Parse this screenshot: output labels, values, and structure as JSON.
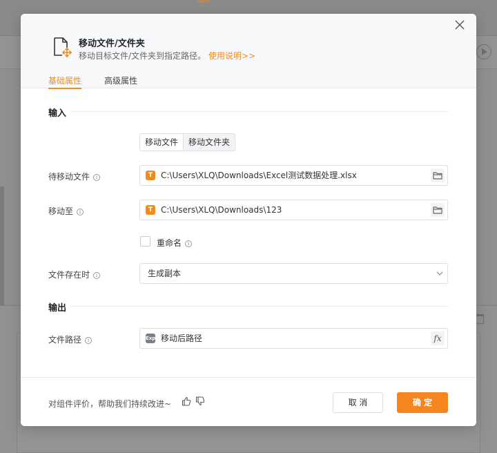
{
  "dialog": {
    "title": "移动文件/文件夹",
    "description": "移动目标文件/文件夹到指定路径。",
    "help_link": "使用说明>>",
    "tabs": {
      "basic": "基础属性",
      "advanced": "高级属性"
    }
  },
  "input_section": {
    "title": "输入",
    "mode": {
      "options": [
        "移动文件",
        "移动文件夹"
      ],
      "selected": "移动文件夹"
    },
    "source_file": {
      "label": "待移动文件",
      "value": "C:\\Users\\XLQ\\Downloads\\Excel测试数据处理.xlsx",
      "badge": "T"
    },
    "destination": {
      "label": "移动至",
      "value": "C:\\Users\\XLQ\\Downloads\\123",
      "badge": "T"
    },
    "rename": {
      "label": "重命名",
      "checked": false
    },
    "on_exists": {
      "label": "文件存在时",
      "value": "生成副本"
    }
  },
  "output_section": {
    "title": "输出",
    "file_path": {
      "label": "文件路径",
      "value": "移动后路径",
      "badge": "Exp",
      "fx": "fx"
    }
  },
  "footer": {
    "feedback": "对组件评价，帮助我们持续改进~",
    "cancel": "取 消",
    "ok": "确 定"
  },
  "colors": {
    "accent": "#f08c1e",
    "primary_button": "#f5861f",
    "border": "#dcdfe6"
  },
  "icons": {
    "header": "move-file-icon",
    "close": "close-icon",
    "info": "info-icon",
    "folder": "folder-icon",
    "chevron": "chevron-down-icon",
    "thumbs_up": "thumbs-up-icon",
    "thumbs_down": "thumbs-down-icon"
  }
}
